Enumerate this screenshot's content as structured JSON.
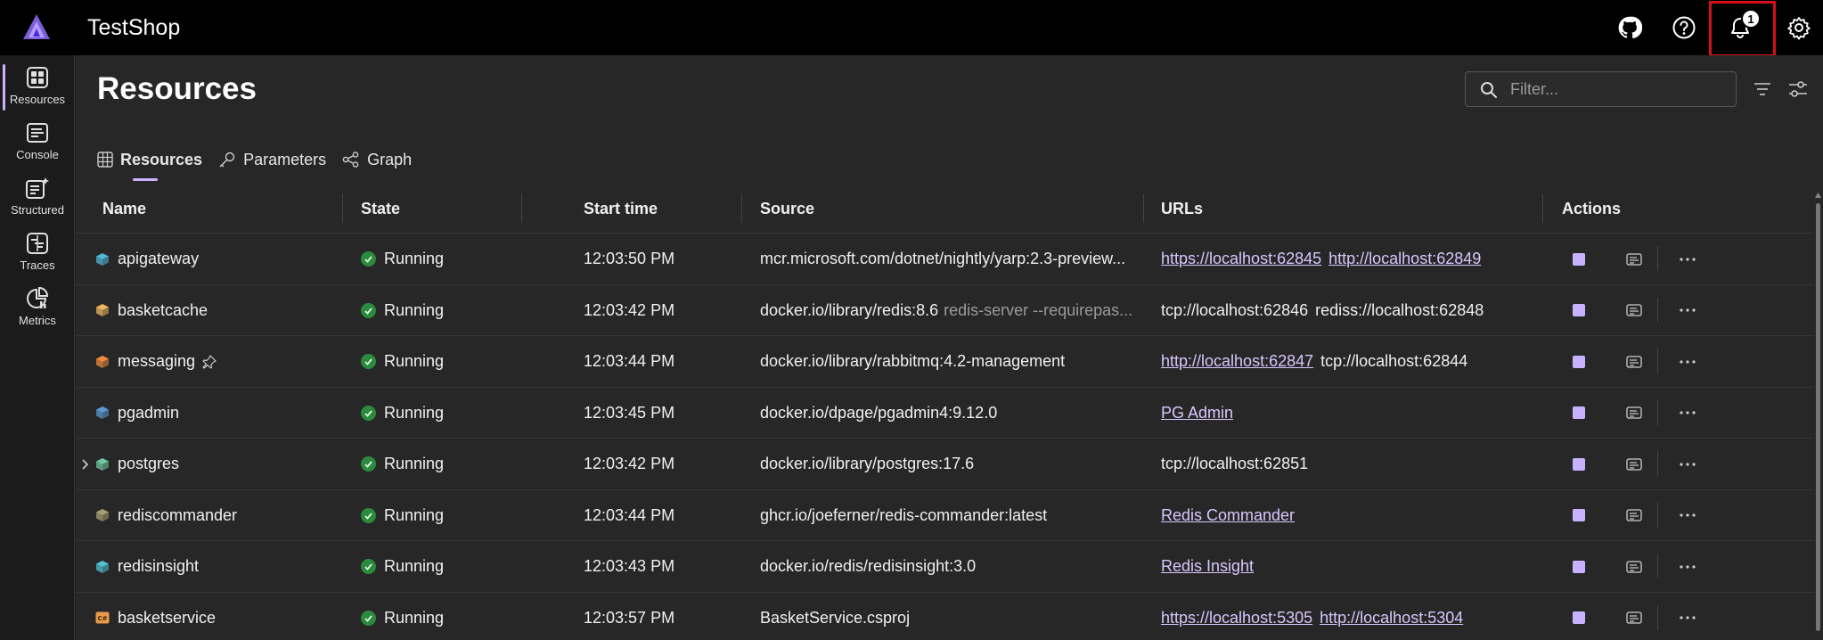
{
  "app": {
    "title": "TestShop"
  },
  "header": {
    "github": "github-icon",
    "help": "help-icon",
    "notifications": {
      "icon": "bell-icon",
      "badge": "1"
    },
    "settings": "gear-icon"
  },
  "sidebar": {
    "items": [
      {
        "label": "Resources",
        "icon": "resources-icon",
        "active": true
      },
      {
        "label": "Console",
        "icon": "console-icon"
      },
      {
        "label": "Structured",
        "icon": "structured-icon"
      },
      {
        "label": "Traces",
        "icon": "traces-icon"
      },
      {
        "label": "Metrics",
        "icon": "metrics-icon"
      }
    ]
  },
  "page": {
    "title": "Resources",
    "filter_placeholder": "Filter...",
    "tabs": [
      {
        "label": "Resources",
        "icon": "table-icon",
        "active": true
      },
      {
        "label": "Parameters",
        "icon": "key-icon"
      },
      {
        "label": "Graph",
        "icon": "graph-icon"
      }
    ]
  },
  "table": {
    "columns": [
      "Name",
      "State",
      "Start time",
      "Source",
      "URLs",
      "Actions"
    ],
    "rows": [
      {
        "name": "apigateway",
        "icon_color": "#4fb8d9",
        "state": "Running",
        "start": "12:03:50 PM",
        "source": "mcr.microsoft.com/dotnet/nightly/yarp:2.3-preview...",
        "source_extra": "",
        "urls": [
          {
            "text": "https://localhost:62845",
            "link": true
          },
          {
            "text": "http://localhost:62849",
            "link": true
          }
        ]
      },
      {
        "name": "basketcache",
        "icon_color": "#f0b860",
        "state": "Running",
        "start": "12:03:42 PM",
        "source": "docker.io/library/redis:8.6",
        "source_extra": "redis-server --requirepas...",
        "urls": [
          {
            "text": "tcp://localhost:62846",
            "link": false
          },
          {
            "text": "rediss://localhost:62848",
            "link": false
          }
        ]
      },
      {
        "name": "messaging",
        "icon_color": "#f08a3c",
        "pinned": true,
        "state": "Running",
        "start": "12:03:44 PM",
        "source": "docker.io/library/rabbitmq:4.2-management",
        "source_extra": "",
        "urls": [
          {
            "text": "http://localhost:62847",
            "link": true
          },
          {
            "text": "tcp://localhost:62844",
            "link": false
          }
        ]
      },
      {
        "name": "pgadmin",
        "icon_color": "#5a9bd4",
        "state": "Running",
        "start": "12:03:45 PM",
        "source": "docker.io/dpage/pgadmin4:9.12.0",
        "source_extra": "",
        "urls": [
          {
            "text": "PG Admin",
            "link": true
          }
        ]
      },
      {
        "name": "postgres",
        "icon_color": "#6fc9a0",
        "expandable": true,
        "state": "Running",
        "start": "12:03:42 PM",
        "source": "docker.io/library/postgres:17.6",
        "source_extra": "",
        "urls": [
          {
            "text": "tcp://localhost:62851",
            "link": false
          }
        ]
      },
      {
        "name": "rediscommander",
        "icon_color": "#a8a070",
        "state": "Running",
        "start": "12:03:44 PM",
        "source": "ghcr.io/joeferner/redis-commander:latest",
        "source_extra": "",
        "urls": [
          {
            "text": "Redis Commander",
            "link": true
          }
        ]
      },
      {
        "name": "redisinsight",
        "icon_color": "#4fc3d0",
        "state": "Running",
        "start": "12:03:43 PM",
        "source": "docker.io/redis/redisinsight:3.0",
        "source_extra": "",
        "urls": [
          {
            "text": "Redis Insight",
            "link": true
          }
        ]
      },
      {
        "name": "basketservice",
        "icon_color": "#e89a4a",
        "icon_text": "C#",
        "state": "Running",
        "start": "12:03:57 PM",
        "source": "BasketService.csproj",
        "source_extra": "",
        "urls": [
          {
            "text": "https://localhost:5305",
            "link": true
          },
          {
            "text": "http://localhost:5304",
            "link": true
          }
        ]
      }
    ]
  },
  "colors": {
    "accent": "#c9b3ff",
    "running": "#2b8a3e",
    "highlight": "#d4101a"
  }
}
